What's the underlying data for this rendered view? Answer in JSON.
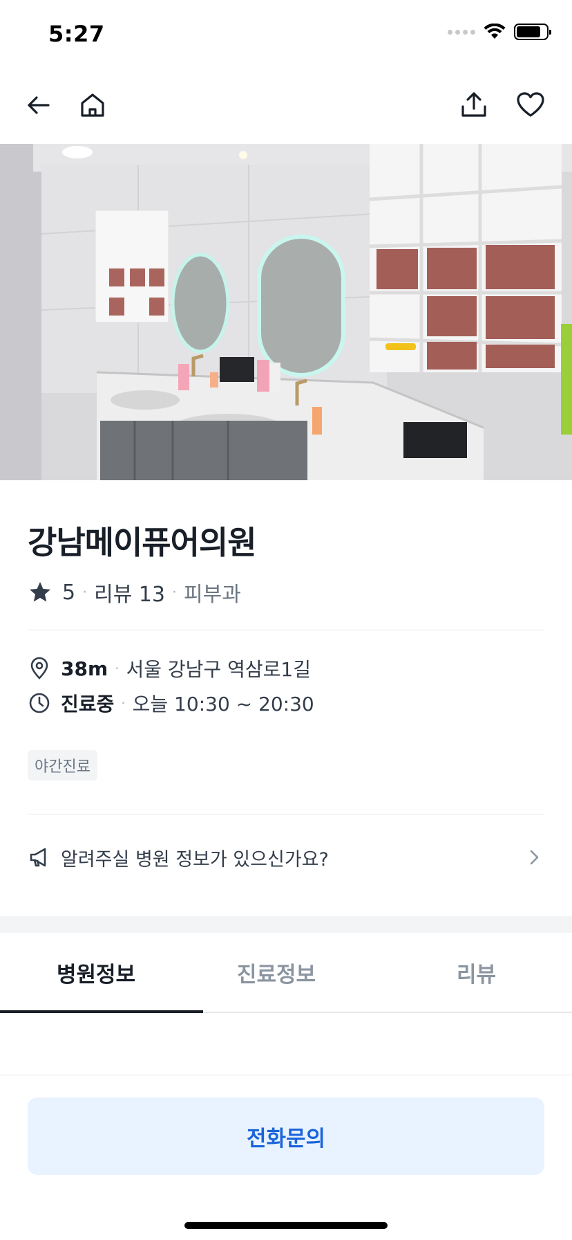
{
  "status_bar": {
    "time": "5:27"
  },
  "nav": {
    "back_icon": "arrow-left-icon",
    "home_icon": "home-icon",
    "share_icon": "share-icon",
    "favorite_icon": "heart-icon"
  },
  "clinic": {
    "name": "강남메이퓨어의원",
    "rating": "5",
    "reviews": "리뷰 13",
    "department": "피부과"
  },
  "location": {
    "distance": "38m",
    "address": "서울 강남구 역삼로1길"
  },
  "hours": {
    "status": "진료중",
    "today": "오늘 10:30 ~ 20:30"
  },
  "tags": [
    "야간진료"
  ],
  "report": {
    "label": "알려주실 병원 정보가 있으신가요?"
  },
  "tabs": [
    {
      "label": "병원정보",
      "active": true
    },
    {
      "label": "진료정보",
      "active": false
    },
    {
      "label": "리뷰",
      "active": false
    }
  ],
  "cta": {
    "label": "전화문의"
  },
  "colors": {
    "accent": "#1b64da",
    "cta_bg": "#e8f3ff",
    "text_primary": "#191f28",
    "text_secondary": "#6b7684"
  }
}
